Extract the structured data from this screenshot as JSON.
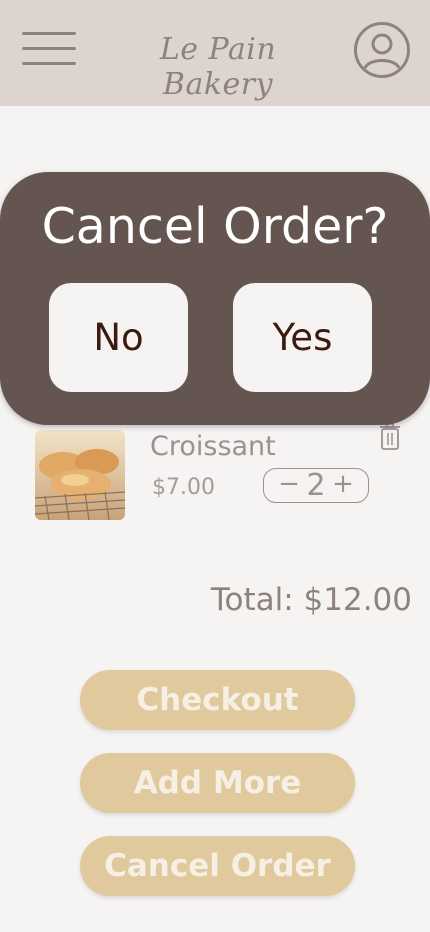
{
  "header": {
    "brand": "Le Pain Bakery",
    "menu_icon": "hamburger-menu-icon",
    "profile_icon": "user-profile-icon"
  },
  "cart": {
    "items": [
      {
        "name": "Croissant",
        "price": "$7.00",
        "quantity": "2",
        "image": "croissant-photo"
      }
    ],
    "stepper": {
      "minus": "−",
      "plus": "+"
    },
    "total": "Total: $12.00"
  },
  "actions": {
    "checkout": "Checkout",
    "add_more": "Add More",
    "cancel_order": "Cancel Order"
  },
  "modal": {
    "title": "Cancel Order?",
    "no": "No",
    "yes": "Yes"
  },
  "colors": {
    "header_bg": "#ded4cf",
    "modal_bg": "#655551",
    "button_bg": "#e0c99d",
    "page_bg": "#f6f3f3"
  }
}
